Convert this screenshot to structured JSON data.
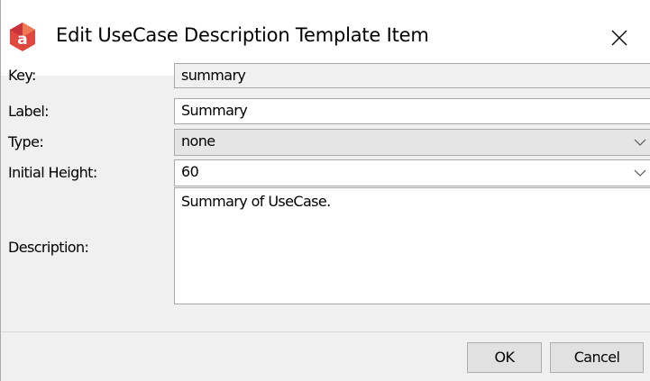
{
  "window": {
    "title": "Edit UseCase Description Template Item",
    "app_icon": "astah-icon",
    "close_icon": "close-icon"
  },
  "form": {
    "key": {
      "label": "Key:",
      "value": "summary"
    },
    "label": {
      "label": "Label:",
      "value": "Summary"
    },
    "type": {
      "label": "Type:",
      "value": "none"
    },
    "initial_height": {
      "label": "Initial Height:",
      "value": "60"
    },
    "description": {
      "label": "Description:",
      "value": "Summary of UseCase."
    }
  },
  "buttons": {
    "ok": "OK",
    "cancel": "Cancel"
  }
}
